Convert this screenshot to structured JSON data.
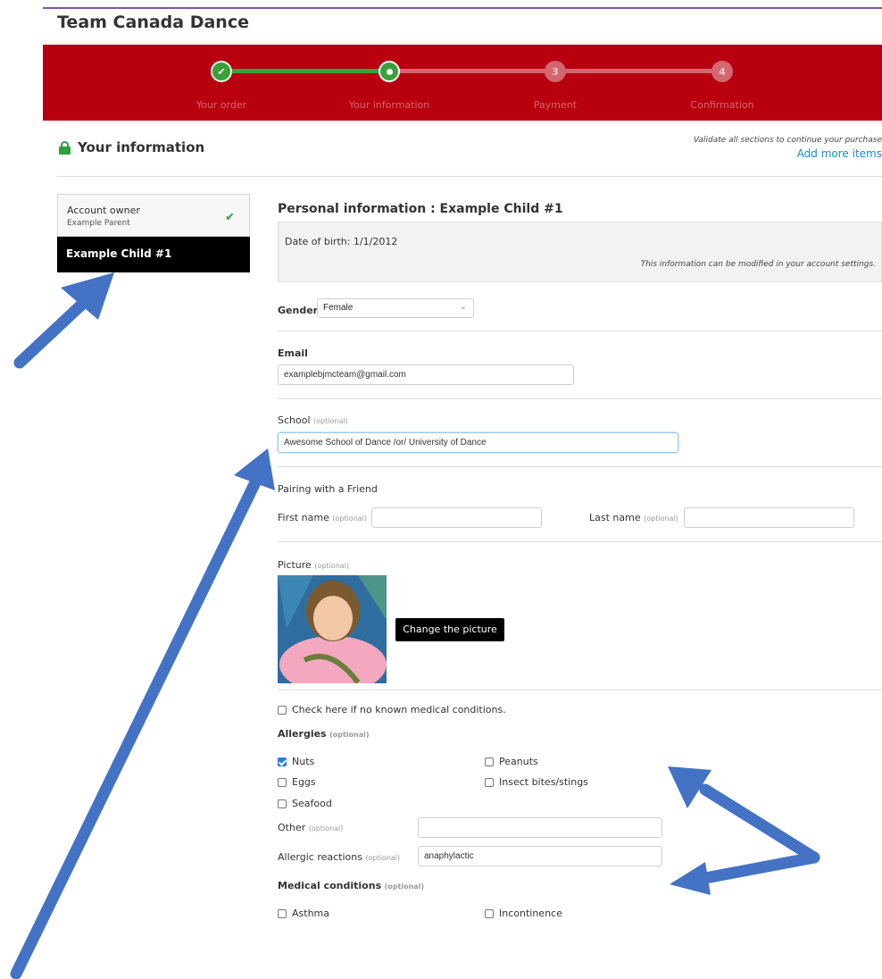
{
  "site": {
    "title": "Team Canada Dance"
  },
  "progress": {
    "steps": [
      {
        "label": "Your order",
        "number": "1",
        "state": "done"
      },
      {
        "label": "Your information",
        "number": "2",
        "state": "current"
      },
      {
        "label": "Payment",
        "number": "3",
        "state": "todo"
      },
      {
        "label": "Confirmation",
        "number": "4",
        "state": "todo"
      }
    ]
  },
  "header": {
    "title": "Your information",
    "validate_note": "Validate all sections to continue your purchase",
    "add_more": "Add more items"
  },
  "nav": {
    "owner_title": "Account owner",
    "owner_name": "Example Parent",
    "child_label": "Example Child #1"
  },
  "form": {
    "personal_heading": "Personal information : Example Child #1",
    "dob": "Date of birth: 1/1/2012",
    "modify_note": "This information can be modified in your account settings.",
    "gender_label": "Gender",
    "gender_value": "Female",
    "email_label": "Email",
    "email_value": "examplebjmcteam@gmail.com",
    "school_label": "School",
    "optional": "(optional)",
    "school_value": "Awesome School of Dance  /or/ University of Dance",
    "pairing_heading": "Pairing with a Friend",
    "first_name_label": "First name",
    "last_name_label": "Last name",
    "picture_label": "Picture",
    "change_picture": "Change the picture",
    "no_medical": "Check here if no known medical conditions.",
    "allergies_label": "Allergies",
    "allergies": [
      {
        "label": "Nuts",
        "checked": true
      },
      {
        "label": "Peanuts",
        "checked": false
      },
      {
        "label": "Eggs",
        "checked": false
      },
      {
        "label": "Insect bites/stings",
        "checked": false
      },
      {
        "label": "Seafood",
        "checked": false
      }
    ],
    "other_label": "Other",
    "other_value": "",
    "reactions_label": "Allergic reactions",
    "reactions_value": "anaphylactic",
    "medical_label": "Medical conditions",
    "medical": [
      {
        "label": "Asthma",
        "checked": false
      },
      {
        "label": "Incontinence",
        "checked": false
      }
    ]
  },
  "colors": {
    "banner": "#b8000f",
    "success": "#3aa13a",
    "link": "#1f87cf",
    "arrow": "#4472c4"
  }
}
